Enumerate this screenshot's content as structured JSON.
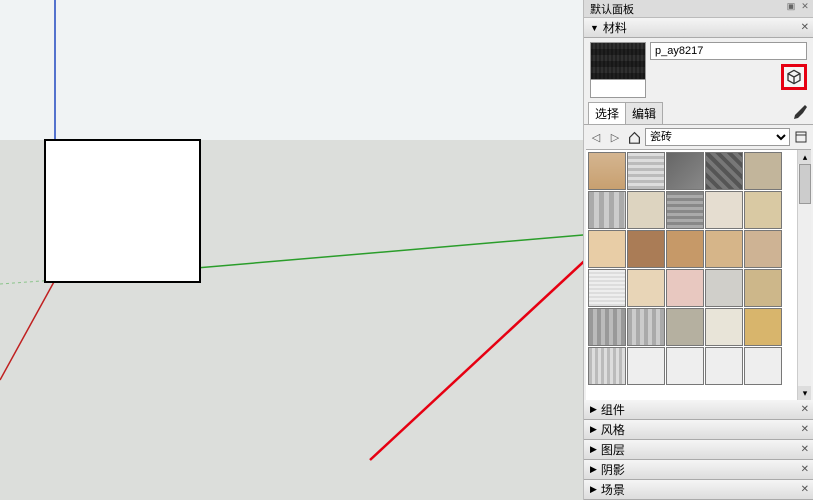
{
  "panel": {
    "title": "默认面板"
  },
  "sections": {
    "materials": "材料",
    "components": "组件",
    "styles": "风格",
    "layers": "图层",
    "shadows": "阴影",
    "scenes": "场景"
  },
  "current_material": {
    "name": "p_ay8217"
  },
  "tabs": {
    "select": "选择",
    "edit": "编辑"
  },
  "library": {
    "category": "瓷砖"
  },
  "swatches": {
    "count": 30
  }
}
